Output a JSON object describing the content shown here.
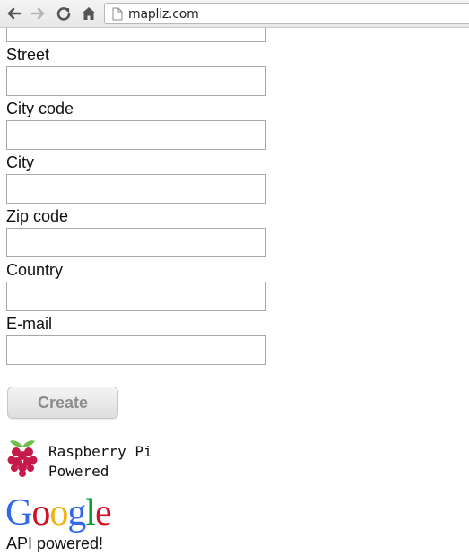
{
  "browser": {
    "url": "mapliz.com"
  },
  "form": {
    "fields": [
      {
        "label": "Street",
        "value": ""
      },
      {
        "label": "City code",
        "value": ""
      },
      {
        "label": "City",
        "value": ""
      },
      {
        "label": "Zip code",
        "value": ""
      },
      {
        "label": "Country",
        "value": ""
      },
      {
        "label": "E-mail",
        "value": ""
      }
    ],
    "create_label": "Create"
  },
  "badges": {
    "rpi_line1": "Raspberry Pi",
    "rpi_line2": "Powered",
    "google_letters": [
      "G",
      "o",
      "o",
      "g",
      "l",
      "e"
    ],
    "api_text": "API powered!"
  },
  "colors": {
    "google_blue": "#3369e8",
    "google_red": "#d50f25",
    "google_yellow": "#eeb211",
    "google_green": "#009925",
    "rpi_red": "#c51a4a",
    "rpi_green": "#6cc04a"
  },
  "icons": [
    "back-arrow-icon",
    "forward-arrow-icon",
    "reload-icon",
    "home-icon",
    "page-icon",
    "raspberry-pi-icon"
  ]
}
